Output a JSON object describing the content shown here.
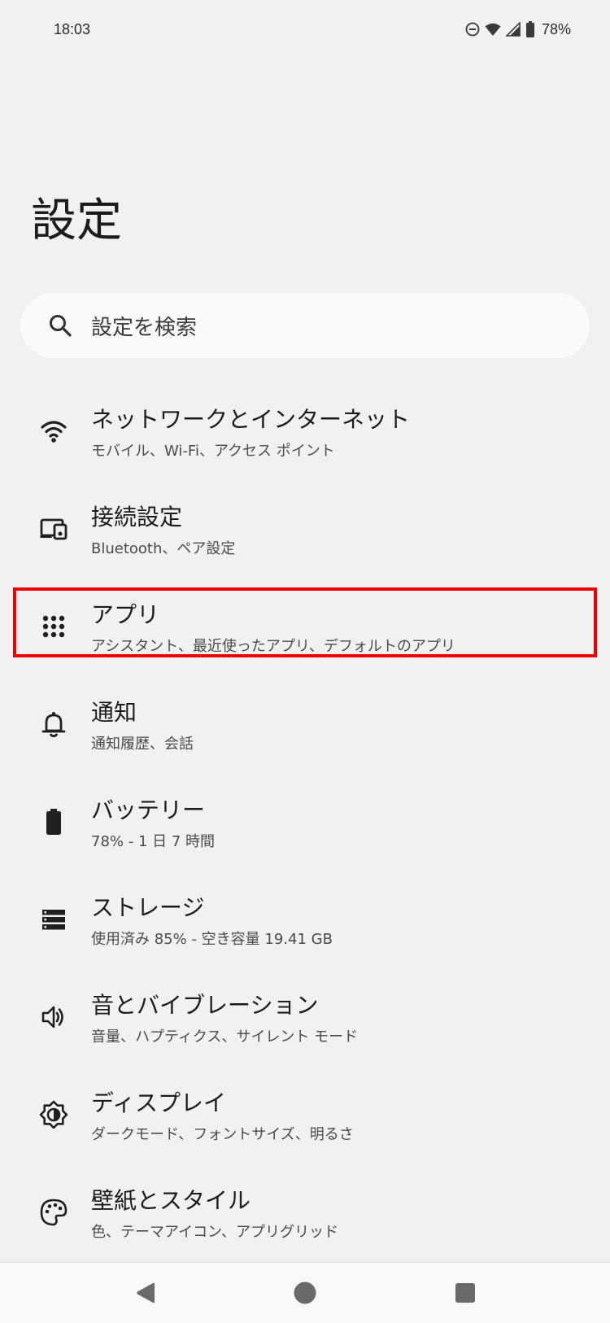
{
  "status_bar": {
    "time": "18:03",
    "battery_percent": "78%",
    "icons": [
      "do-not-disturb-icon",
      "wifi-icon",
      "signal-icon",
      "battery-icon"
    ]
  },
  "page": {
    "title": "設定"
  },
  "search": {
    "placeholder": "設定を検索"
  },
  "settings": {
    "items": [
      {
        "icon": "wifi-icon",
        "title": "ネットワークとインターネット",
        "subtitle": "モバイル、Wi-Fi、アクセス ポイント"
      },
      {
        "icon": "connected-devices-icon",
        "title": "接続設定",
        "subtitle": "Bluetooth、ペア設定"
      },
      {
        "icon": "apps-grid-icon",
        "title": "アプリ",
        "subtitle": "アシスタント、最近使ったアプリ、デフォルトのアプリ"
      },
      {
        "icon": "bell-icon",
        "title": "通知",
        "subtitle": "通知履歴、会話"
      },
      {
        "icon": "battery-icon",
        "title": "バッテリー",
        "subtitle": "78% - 1 日 7 時間"
      },
      {
        "icon": "storage-icon",
        "title": "ストレージ",
        "subtitle": "使用済み 85% - 空き容量 19.41 GB"
      },
      {
        "icon": "volume-icon",
        "title": "音とバイブレーション",
        "subtitle": "音量、ハプティクス、サイレント モード"
      },
      {
        "icon": "display-brightness-icon",
        "title": "ディスプレイ",
        "subtitle": "ダークモード、フォントサイズ、明るさ"
      },
      {
        "icon": "palette-icon",
        "title": "壁紙とスタイル",
        "subtitle": "色、テーマアイコン、アプリグリッド"
      }
    ]
  },
  "highlight": {
    "target": "アプリ",
    "color": "#ee0000"
  },
  "nav_bar": {
    "buttons": [
      "back-icon",
      "home-icon",
      "recents-icon"
    ]
  }
}
